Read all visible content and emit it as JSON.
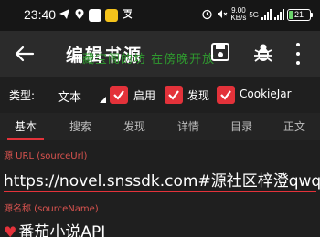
{
  "status_bar": {
    "time": "23:40",
    "speed_value": "9.00",
    "speed_unit": "KB/s",
    "network": "5G",
    "battery_level": "21",
    "icons": [
      "telegram-icon",
      "location-icon",
      "bluetooth-icon",
      "notes-icon",
      "translate-icon",
      "alarm-icon",
      "mute-icon"
    ]
  },
  "toolbar": {
    "title": "编辑书源",
    "watermark": "藏宝阁的坊 在傍晚开放"
  },
  "options": {
    "type_label": "类型:",
    "type_value": "文本",
    "checkboxes": [
      {
        "label": "启用",
        "checked": true
      },
      {
        "label": "发现",
        "checked": true
      },
      {
        "label": "CookieJar",
        "checked": true
      }
    ]
  },
  "tabs": [
    "基本",
    "搜索",
    "发现",
    "详情",
    "目录",
    "正文"
  ],
  "active_tab": "基本",
  "form": {
    "url_label": "源 URL (sourceUrl)",
    "url_value": "https://novel.snssdk.com#源社区梓澄qwq",
    "name_label": "源名称 (sourceName)",
    "name_value": "番茄小说API"
  },
  "colors": {
    "accent": "#e3323a",
    "watermark": "#2f9a2f",
    "battery": "#6bd36b",
    "background": "#1f1f1f",
    "toolbar": "#2b2b2b"
  }
}
